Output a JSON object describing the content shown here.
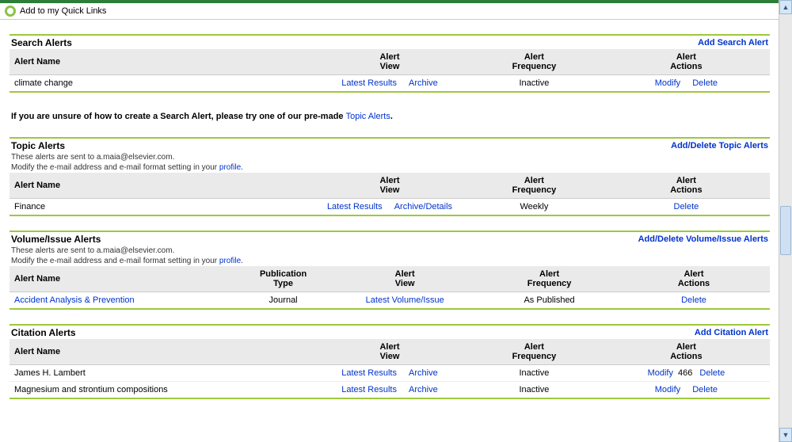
{
  "quickLinks": {
    "label": "Add to my Quick Links"
  },
  "info": {
    "prefix": "If you are unsure of how to create a Search Alert, please try one of our pre-made ",
    "link": "Topic Alerts",
    "suffix": "."
  },
  "noteEmail": "These alerts are sent to a.maia@elsevier.com.",
  "noteProfilePrefix": "Modify the e-mail address and e-mail format setting in your ",
  "noteProfileLink": "profile",
  "noteProfileSuffix": ".",
  "cols": {
    "name": "Alert Name",
    "pubType1": "Publication",
    "pubType2": "Type",
    "view1": "Alert",
    "view2": "View",
    "freq1": "Alert",
    "freq2": "Frequency",
    "act1": "Alert",
    "act2": "Actions"
  },
  "links": {
    "latest": "Latest Results",
    "archive": "Archive",
    "archiveDetails": "Archive/Details",
    "latestVol": "Latest Volume/Issue",
    "modify": "Modify",
    "delete": "Delete"
  },
  "search": {
    "title": "Search Alerts",
    "addLink": "Add Search Alert",
    "rows": [
      {
        "name": "climate change",
        "freq": "Inactive"
      }
    ]
  },
  "topic": {
    "title": "Topic Alerts",
    "addLink": "Add/Delete Topic Alerts",
    "rows": [
      {
        "name": "Finance",
        "freq": "Weekly"
      }
    ]
  },
  "volume": {
    "title": "Volume/Issue Alerts",
    "addLink": "Add/Delete Volume/Issue Alerts",
    "rows": [
      {
        "name": "Accident Analysis & Prevention",
        "pubType": "Journal",
        "freq": "As Published"
      }
    ]
  },
  "citation": {
    "title": "Citation Alerts",
    "addLink": "Add Citation Alert",
    "rows": [
      {
        "name": "James H. Lambert",
        "freq": "Inactive"
      },
      {
        "name": "Magnesium and strontium compositions",
        "freq": "Inactive"
      }
    ]
  }
}
